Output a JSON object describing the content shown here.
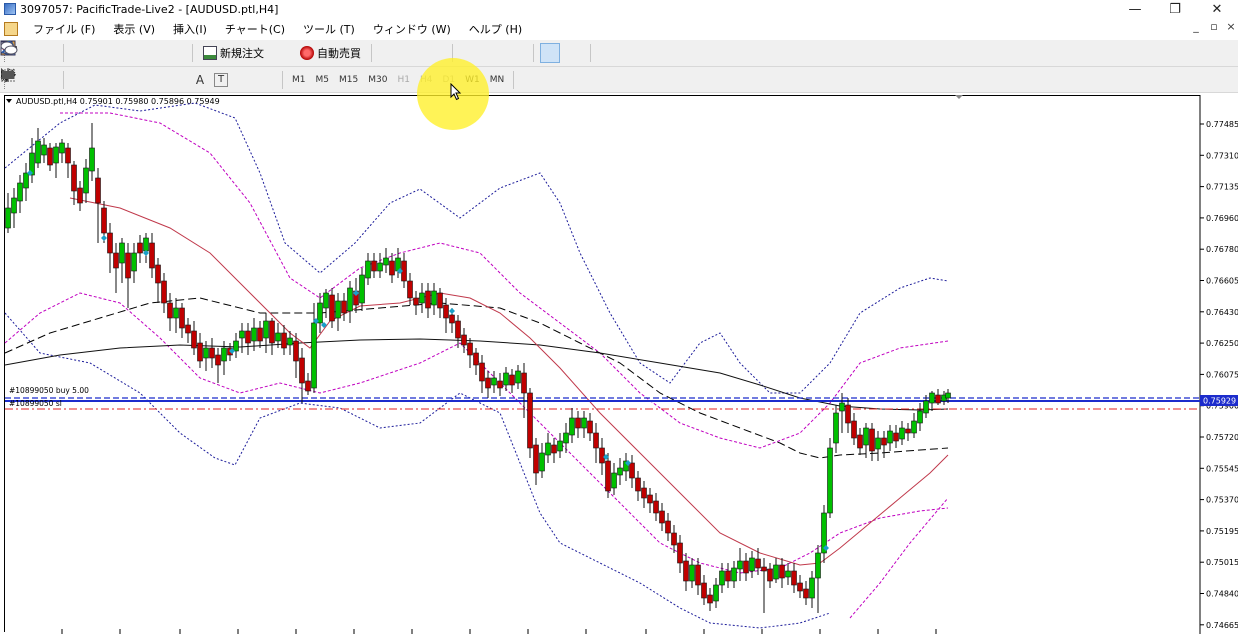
{
  "window": {
    "title": "3097057: PacificTrade-Live2 - [AUDUSD.ptl,H4]",
    "controls": {
      "minimize": "—",
      "restore": "❐",
      "close": "✕"
    }
  },
  "menu": {
    "items": [
      "ファイル (F)",
      "表示 (V)",
      "挿入(I)",
      "チャート(C)",
      "ツール (T)",
      "ウィンドウ (W)",
      "ヘルプ (H)"
    ]
  },
  "toolbar": {
    "new_order": "新規注文",
    "auto_trade": "自動売買",
    "timeframes": [
      "M1",
      "M5",
      "M15",
      "M30",
      "H1",
      "H4",
      "D1",
      "W1",
      "MN"
    ],
    "active_timeframe": "H4",
    "text_tool": "A",
    "label_tool": "T"
  },
  "chart": {
    "header": "AUDUSD.ptl,H4  0.75901 0.75980 0.75896 0.75949",
    "order_label_buy": "#10899050 buy 5.00",
    "order_label_sl": "#10899050 sl",
    "current_price": "0.75929",
    "price_axis": [
      "0.77485",
      "0.77310",
      "0.77135",
      "0.76960",
      "0.76780",
      "0.76605",
      "0.76430",
      "0.76250",
      "0.76075",
      "0.75900",
      "0.75720",
      "0.75545",
      "0.75370",
      "0.75195",
      "0.75015",
      "0.74840",
      "0.74665"
    ],
    "colors": {
      "bull": "#00c000",
      "bear": "#c00000",
      "price_line": "#1c2ccc",
      "sl_line": "#e02020",
      "envelope_blue": "#1c1c9a",
      "envelope_purple": "#c000c0"
    }
  }
}
